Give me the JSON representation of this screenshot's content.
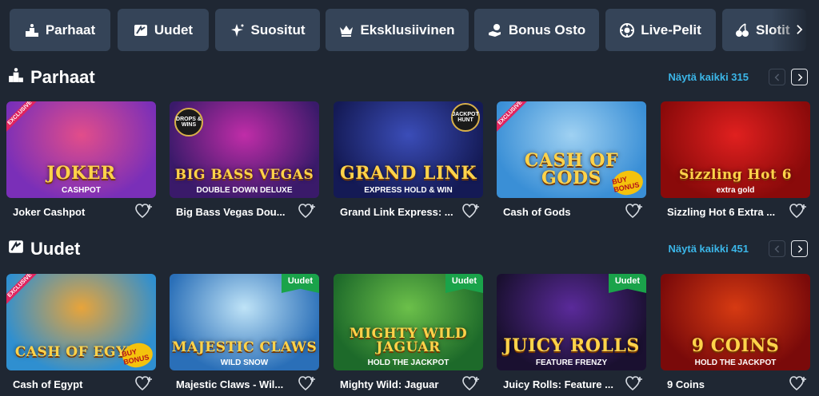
{
  "categories": [
    {
      "label": "Parhaat",
      "icon": "podium-icon"
    },
    {
      "label": "Uudet",
      "icon": "new-tag-icon"
    },
    {
      "label": "Suositut",
      "icon": "sparkle-star-icon"
    },
    {
      "label": "Eksklusiivinen",
      "icon": "crown-icon"
    },
    {
      "label": "Bonus Osto",
      "icon": "hand-coin-icon"
    },
    {
      "label": "Live-Pelit",
      "icon": "roulette-chip-icon"
    },
    {
      "label": "Slotit",
      "icon": "cherries-icon"
    }
  ],
  "sections": [
    {
      "title": "Parhaat",
      "icon": "podium-icon",
      "view_all": "Näytä kaikki 315",
      "games": [
        {
          "name": "Joker Cashpot",
          "art_logo": "JOKER",
          "art_sub": "CASHPOT",
          "badge": "EXCLUSIVE",
          "colors": [
            "#7a2fb8",
            "#e24d8a"
          ]
        },
        {
          "name": "Big Bass Vegas Dou...",
          "art_logo": "BIG BASS VEGAS",
          "art_sub": "DOUBLE DOWN DELUXE",
          "badge": "DROPS & WINS",
          "colors": [
            "#3a1a6a",
            "#c02da8"
          ]
        },
        {
          "name": "Grand Link Express: ...",
          "art_logo": "GRAND LINK",
          "art_sub": "EXPRESS HOLD & WIN",
          "badge": "JACKPOT HUNT",
          "colors": [
            "#141a55",
            "#3b4db8"
          ]
        },
        {
          "name": "Cash of Gods",
          "art_logo": "CASH OF GODS",
          "art_sub": "",
          "badge": "EXCLUSIVE",
          "colors": [
            "#3a8fd6",
            "#9fd1f2"
          ],
          "bonus": "BUY BONUS"
        },
        {
          "name": "Sizzling Hot 6 Extra ...",
          "art_logo": "Sizzling Hot 6",
          "art_sub": "extra gold",
          "badge": "",
          "colors": [
            "#8a0a0a",
            "#e0201f"
          ]
        }
      ]
    },
    {
      "title": "Uudet",
      "icon": "new-tag-icon",
      "view_all": "Näytä kaikki 451",
      "games": [
        {
          "name": "Cash of Egypt",
          "art_logo": "CASH OF EGYPT",
          "art_sub": "",
          "badge": "EXCLUSIVE",
          "colors": [
            "#2f8fd0",
            "#e8a43a"
          ],
          "bonus": "BUY BONUS"
        },
        {
          "name": "Majestic Claws - Wil...",
          "art_logo": "MAJESTIC CLAWS",
          "art_sub": "WILD SNOW",
          "badge": "Uudet",
          "colors": [
            "#2a6fb8",
            "#bfe3f7"
          ]
        },
        {
          "name": "Mighty Wild: Jaguar",
          "art_logo": "MIGHTY WILD JAGUAR",
          "art_sub": "HOLD THE JACKPOT",
          "badge": "Uudet",
          "colors": [
            "#1d6a2a",
            "#6cc04a"
          ]
        },
        {
          "name": "Juicy Rolls: Feature ...",
          "art_logo": "JUICY ROLLS",
          "art_sub": "FEATURE FRENZY",
          "badge": "Uudet",
          "colors": [
            "#1a1030",
            "#5a2a9a"
          ]
        },
        {
          "name": "9 Coins",
          "art_logo": "9 COINS",
          "art_sub": "HOLD THE JACKPOT",
          "badge": "",
          "colors": [
            "#7a0a0a",
            "#d63a12"
          ]
        }
      ]
    }
  ],
  "labels": {
    "exclusive": "EXCLUSIVE",
    "new": "Uudet"
  }
}
